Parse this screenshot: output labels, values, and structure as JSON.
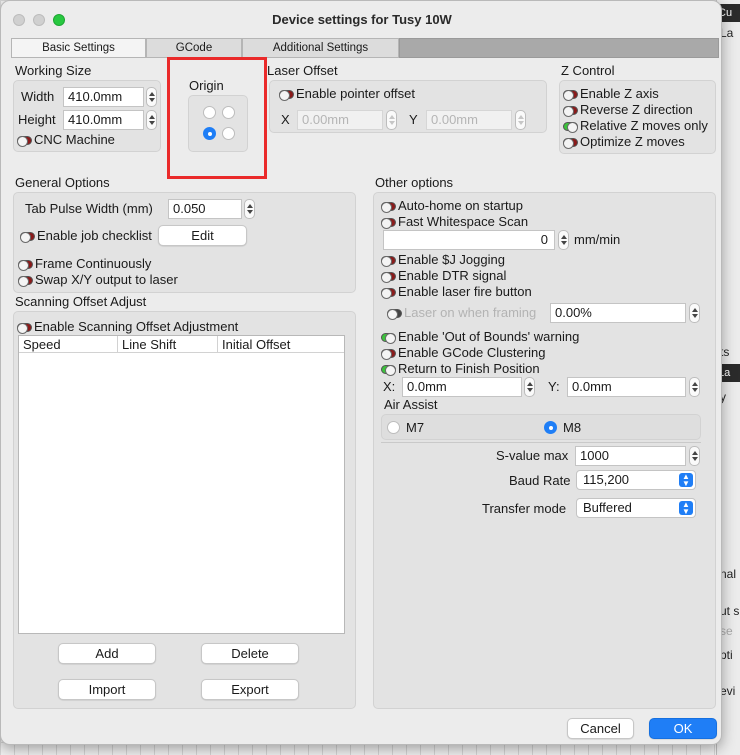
{
  "window": {
    "title": "Device settings for Tusy 10W"
  },
  "tabs": [
    {
      "label": "Basic Settings",
      "active": true
    },
    {
      "label": "GCode",
      "active": false
    },
    {
      "label": "Additional Settings",
      "active": false
    }
  ],
  "working_size": {
    "heading": "Working Size",
    "width_label": "Width",
    "width_value": "410.0mm",
    "height_label": "Height",
    "height_value": "410.0mm",
    "cnc_label": "CNC Machine",
    "cnc_on": false
  },
  "origin": {
    "heading": "Origin",
    "selected": "bottom-left"
  },
  "laser_offset": {
    "heading": "Laser Offset",
    "enable_label": "Enable pointer offset",
    "enable_on": false,
    "x_label": "X",
    "x_value": "0.00mm",
    "y_label": "Y",
    "y_value": "0.00mm"
  },
  "z_control": {
    "heading": "Z Control",
    "items": [
      {
        "label": "Enable Z axis",
        "on": false
      },
      {
        "label": "Reverse Z direction",
        "on": false
      },
      {
        "label": "Relative Z moves only",
        "on": true
      },
      {
        "label": "Optimize Z moves",
        "on": false
      }
    ]
  },
  "general_options": {
    "heading": "General Options",
    "tab_pulse_label": "Tab Pulse Width (mm)",
    "tab_pulse_value": "0.050",
    "job_checklist_label": "Enable job checklist",
    "edit_label": "Edit",
    "frame_continuously_label": "Frame Continuously",
    "swap_xy_label": "Swap X/Y output to laser"
  },
  "scanning_offset": {
    "heading": "Scanning Offset Adjust",
    "enable_label": "Enable Scanning Offset Adjustment",
    "columns": [
      "Speed",
      "Line Shift",
      "Initial Offset"
    ],
    "rows": [],
    "add_label": "Add",
    "delete_label": "Delete",
    "import_label": "Import",
    "export_label": "Export"
  },
  "other_options": {
    "heading": "Other options",
    "auto_home_label": "Auto-home on startup",
    "fast_whitespace_label": "Fast Whitespace Scan",
    "whitespace_value": "0",
    "whitespace_unit": "mm/min",
    "sj_jogging_label": "Enable $J Jogging",
    "dtr_label": "Enable DTR signal",
    "fire_button_label": "Enable laser fire button",
    "laser_framing_label": "Laser on when framing",
    "laser_framing_value": "0.00%",
    "out_of_bounds_label": "Enable 'Out of Bounds' warning",
    "gcode_clustering_label": "Enable GCode Clustering",
    "return_finish_label": "Return to Finish Position",
    "finish_x_label": "X:",
    "finish_x_value": "0.0mm",
    "finish_y_label": "Y:",
    "finish_y_value": "0.0mm",
    "air_assist_heading": "Air Assist",
    "m7_label": "M7",
    "m8_label": "M8",
    "air_assist_selected": "M8",
    "svalue_label": "S-value max",
    "svalue_value": "1000",
    "baud_label": "Baud Rate",
    "baud_value": "115,200",
    "transfer_label": "Transfer mode",
    "transfer_value": "Buffered"
  },
  "footer": {
    "cancel_label": "Cancel",
    "ok_label": "OK"
  },
  "background_app": {
    "frag_1": "Cu",
    "frag_2": "La",
    "frag_3": "ts",
    "frag_4": "La",
    "frag_5": "y",
    "frag_6": "nal",
    "frag_7": "ut s",
    "frag_8": "se",
    "frag_9": "pti",
    "frag_10": "evi"
  },
  "colors": {
    "accent": "#1f7ef6",
    "toggle_off": "#8a1a1a",
    "toggle_on": "#3bc33b",
    "highlight": "#ea2a2a"
  }
}
